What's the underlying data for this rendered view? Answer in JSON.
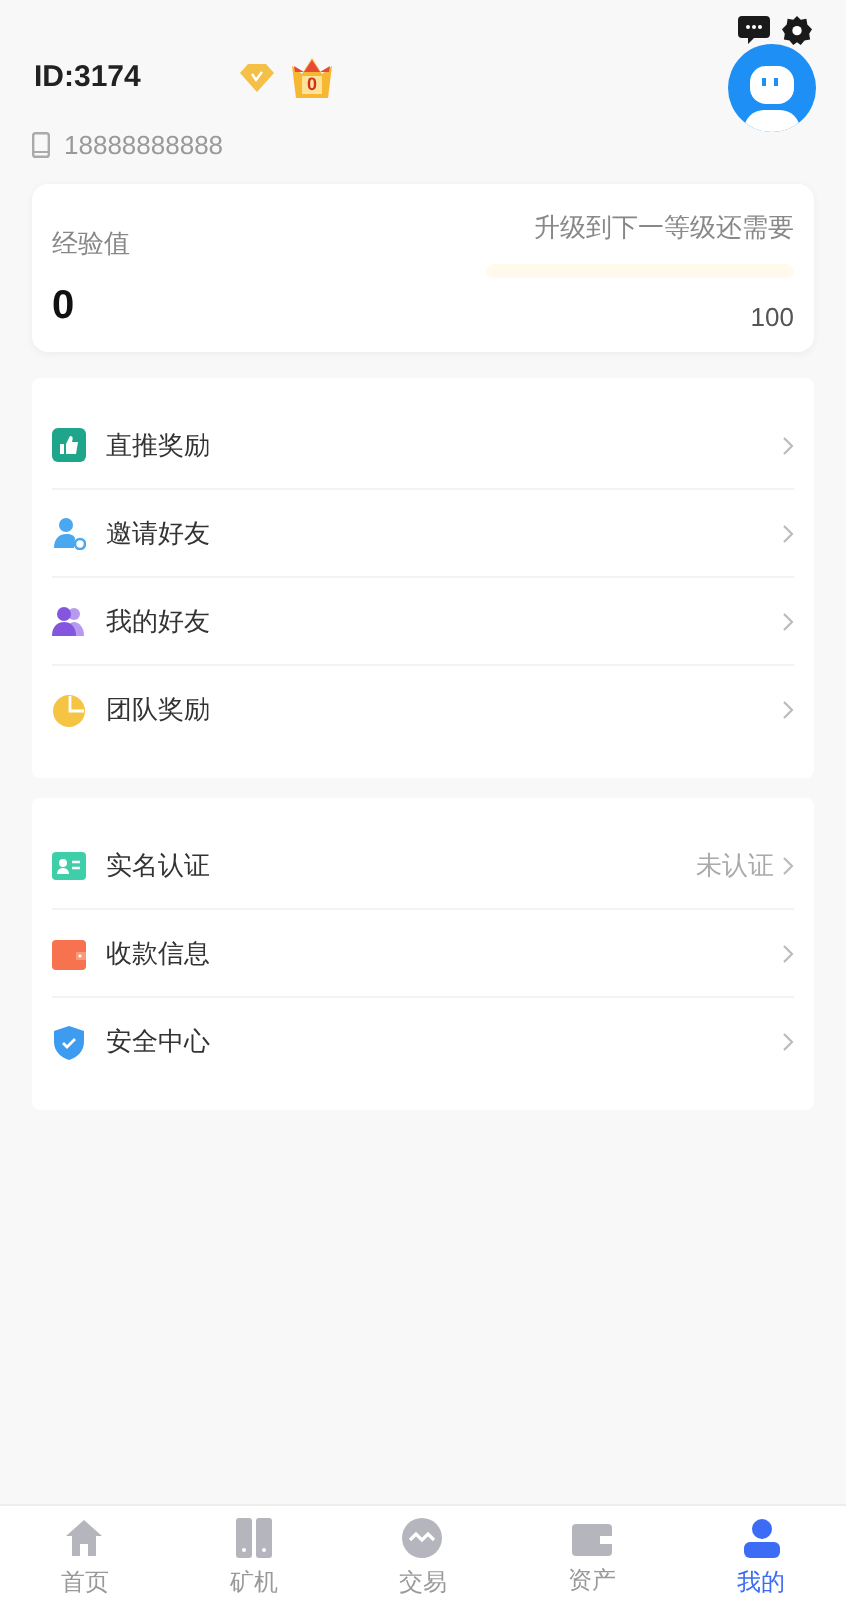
{
  "header": {
    "id": "ID:3174",
    "crown_count": "0",
    "phone": "18888888888"
  },
  "exp": {
    "label": "经验值",
    "value": "0",
    "next_label": "升级到下一等级还需要",
    "level": 0,
    "target": "100"
  },
  "menu_groups": [
    {
      "items": [
        {
          "kind": "thumb",
          "label": "直推奖励"
        },
        {
          "kind": "invite",
          "label": "邀请好友"
        },
        {
          "kind": "friends",
          "label": "我的好友"
        },
        {
          "kind": "team",
          "label": "团队奖励"
        }
      ]
    },
    {
      "items": [
        {
          "kind": "idcard",
          "label": "实名认证",
          "status": "未认证"
        },
        {
          "kind": "wallet",
          "label": "收款信息"
        },
        {
          "kind": "shield",
          "label": "安全中心"
        }
      ]
    }
  ],
  "tabs": [
    {
      "kind": "home",
      "label": "首页",
      "selected": false
    },
    {
      "kind": "miner",
      "label": "矿机",
      "selected": false
    },
    {
      "kind": "trade",
      "label": "交易",
      "selected": false
    },
    {
      "kind": "assets",
      "label": "资产",
      "selected": false
    },
    {
      "kind": "me",
      "label": "我的",
      "selected": true
    }
  ]
}
